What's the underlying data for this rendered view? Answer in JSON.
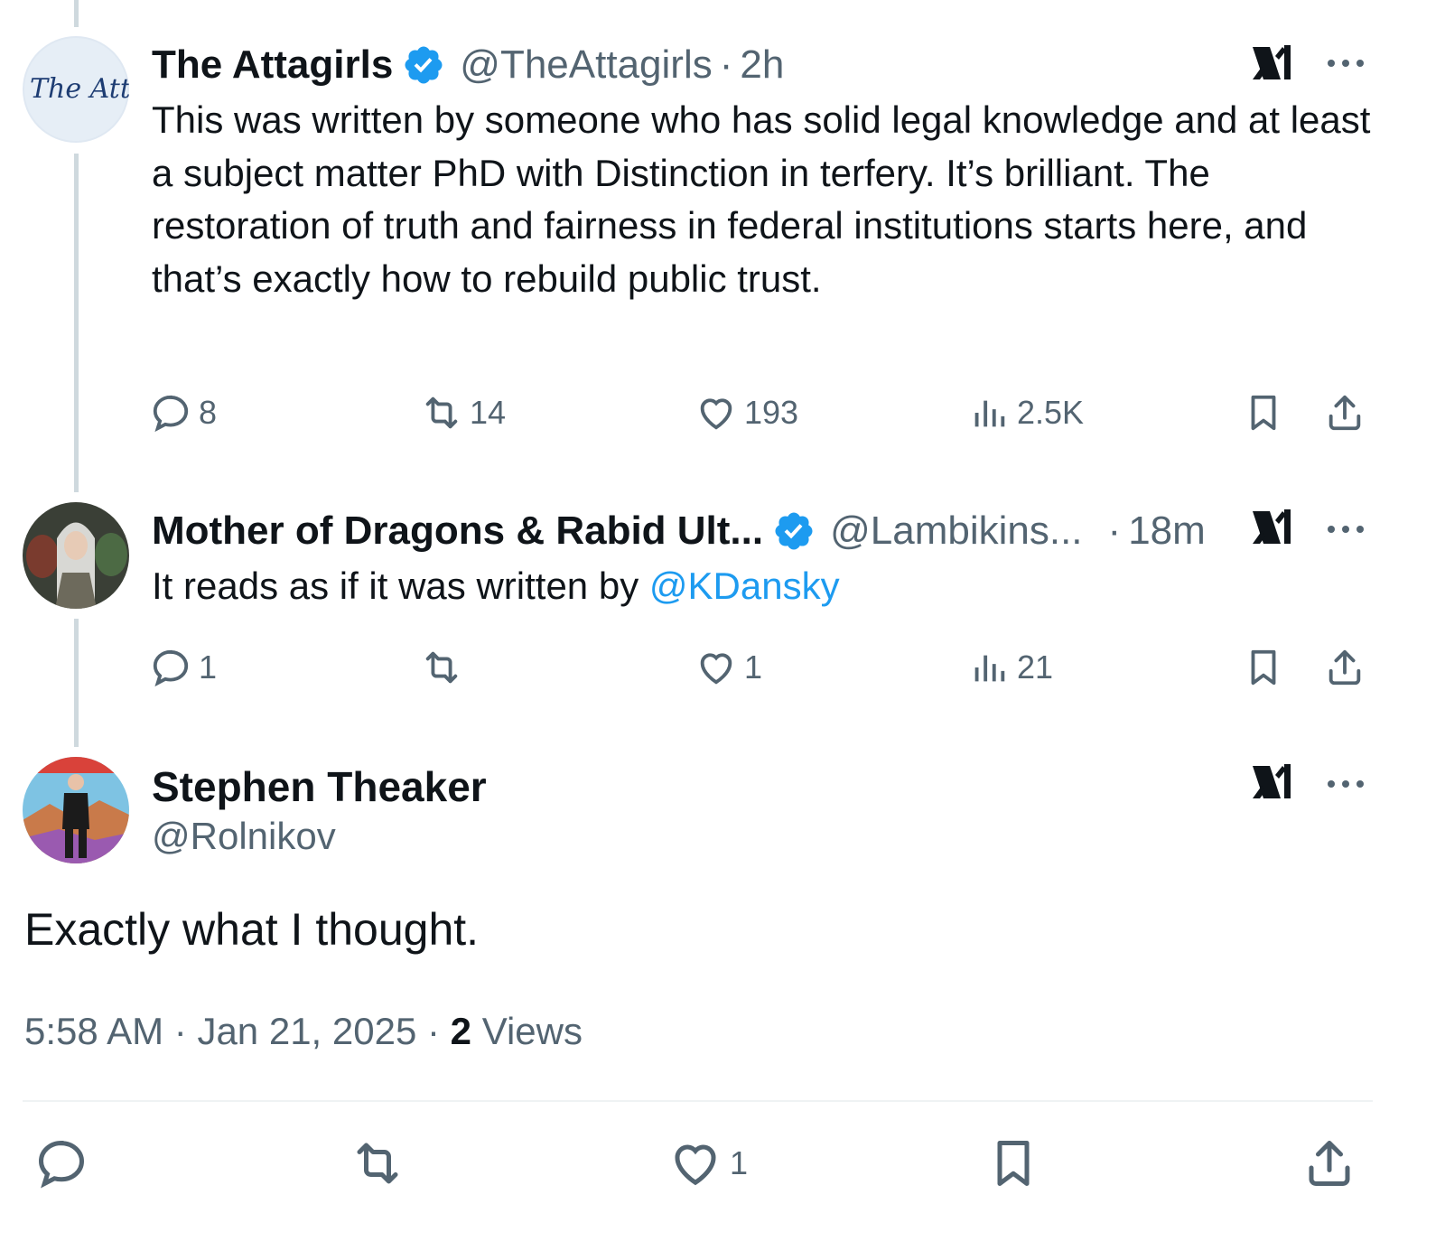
{
  "tweets": [
    {
      "name": "The Attagirls",
      "handle": "@TheAttagirls",
      "time": "2h",
      "avatar_text": "The Attagi",
      "text": "This was written by someone who has solid legal knowledge and at least a subject matter PhD with Distinction in terfery. It’s brilliant. The restoration of truth and fairness in federal institutions starts here, and that’s exactly how to rebuild public trust.",
      "replies": "8",
      "reposts": "14",
      "likes": "193",
      "views": "2.5K"
    },
    {
      "name": "Mother of Dragons & Rabid Ult...",
      "handle": "@Lambikins...",
      "time": "18m",
      "text_before": "It reads as if it was written by ",
      "mention": "@KDansky",
      "replies": "1",
      "reposts": "",
      "likes": "1",
      "views": "21"
    }
  ],
  "main_tweet": {
    "name": "Stephen Theaker",
    "handle": "@Rolnikov",
    "text": "Exactly what I thought.",
    "time": "5:58 AM",
    "date": "Jan 21, 2025",
    "views_count": "2",
    "views_label": "Views",
    "likes": "1"
  },
  "separator": "·",
  "colors": {
    "accent": "#1d9bf0",
    "secondary_text": "#536471",
    "primary_text": "#0f1419",
    "thread_line": "#cfd9de"
  },
  "icons": [
    "verified-badge-icon",
    "grok-icon",
    "more-icon",
    "reply-icon",
    "repost-icon",
    "like-icon",
    "views-icon",
    "bookmark-icon",
    "share-icon"
  ]
}
